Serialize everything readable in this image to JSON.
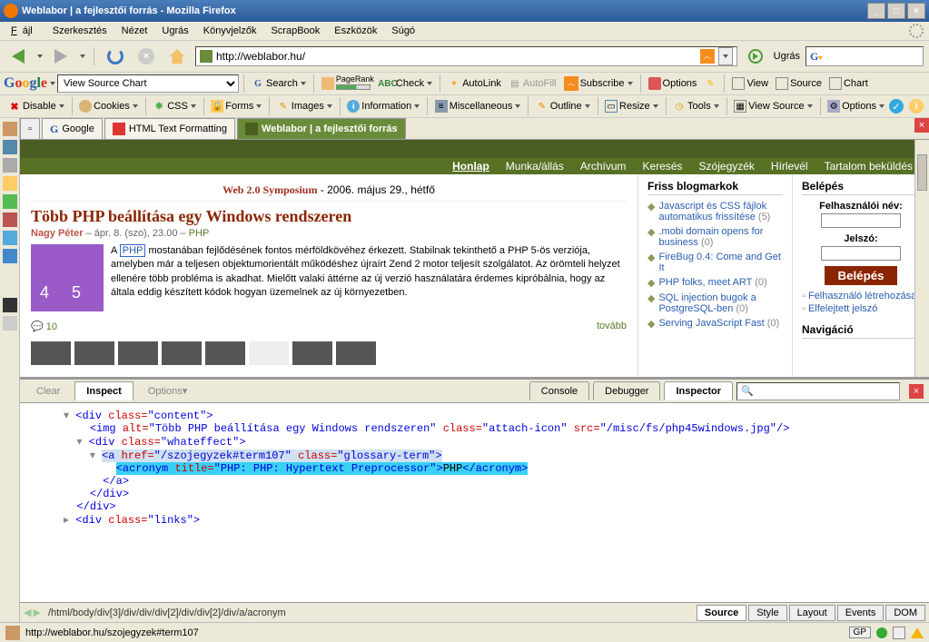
{
  "window": {
    "title": "Weblabor | a fejlesztői forrás - Mozilla Firefox",
    "min": "_",
    "max": "□",
    "close": "×"
  },
  "menu": {
    "file": "Fájl",
    "edit": "Szerkesztés",
    "view": "Nézet",
    "go": "Ugrás",
    "bookmarks": "Könyvjelzők",
    "scrapbook": "ScrapBook",
    "tools": "Eszközök",
    "help": "Súgó"
  },
  "nav": {
    "url": "http://weblabor.hu/",
    "go_label": "Ugrás"
  },
  "google_bar": {
    "search_value": "View Source Chart",
    "search": "Search",
    "pagerank": "PageRank",
    "abc": "ABC",
    "check": "Check",
    "autolink": "AutoLink",
    "autofill": "AutoFill",
    "subscribe": "Subscribe",
    "options": "Options",
    "view": "View",
    "source": "Source",
    "chart": "Chart"
  },
  "webdev_bar": {
    "disable": "Disable",
    "cookies": "Cookies",
    "css": "CSS",
    "forms": "Forms",
    "images": "Images",
    "info": "Information",
    "misc": "Miscellaneous",
    "outline": "Outline",
    "resize": "Resize",
    "tools": "Tools",
    "viewsource": "View Source",
    "options": "Options"
  },
  "tabs": {
    "google": "Google",
    "htmlfmt": "HTML Text Formatting",
    "weblabor": "Weblabor | a fejlesztői forrás"
  },
  "weblabor_nav": [
    "Honlap",
    "Munka/állás",
    "Archívum",
    "Keresés",
    "Szójegyzék",
    "Hírlevél",
    "Tartalom beküldés"
  ],
  "symposium": {
    "title": "Web 2.0 Symposium",
    "date": " - 2006. május 29., hétfő"
  },
  "article": {
    "title": "Több PHP beállítása egy Windows rendszeren",
    "author": "Nagy Péter",
    "meta_sep": " – ápr. 8. (szo), 23.00 – ",
    "php": "PHP",
    "body_pre": "A ",
    "php_hl": "PHP",
    "body": " mostanában fejlődésének fontos mérföldkövéhez érkezett. Stabilnak tekinthető a PHP 5-ös verziója, amelyben már a teljesen objektumorientált működéshez újraírt Zend 2 motor teljesít szolgálatot. Az örömteli helyzet ellenére több probléma is akadhat. Mielőtt valaki áttérne az új verzió használatára érdemes kipróbálnia, hogy az általa eddig készített kódok hogyan üzemelnek az új környezetben.",
    "comments_icon": "💬",
    "comments": "10",
    "more": "tovább"
  },
  "blogmarks": {
    "title": "Friss blogmarkok",
    "items": [
      {
        "text": "Javascript és CSS fájlok automatikus frissítése",
        "count": "(5)"
      },
      {
        "text": ".mobi domain opens for business",
        "count": "(0)"
      },
      {
        "text": "FireBug 0.4: Come and Get It",
        "count": ""
      },
      {
        "text": "PHP folks, meet ART",
        "count": "(0)"
      },
      {
        "text": "SQL injection bugok a PostgreSQL-ben",
        "count": "(0)"
      },
      {
        "text": "Serving JavaScript Fast",
        "count": "(0)"
      }
    ]
  },
  "login": {
    "title": "Belépés",
    "user": "Felhasználói név:",
    "pass": "Jelszó:",
    "button": "Belépés",
    "links": [
      "Felhasználó létrehozása",
      "Elfelejtett jelszó"
    ],
    "nav_title": "Navigáció"
  },
  "firebug": {
    "clear": "Clear",
    "inspect": "Inspect",
    "options": "Options",
    "console": "Console",
    "debugger": "Debugger",
    "inspector": "Inspector",
    "bottom_buttons": [
      "Source",
      "Style",
      "Layout",
      "Events",
      "DOM"
    ],
    "breadcrumb": "/html/body/div[3]/div/div/div[2]/div/div[2]/div/a/acronym",
    "code": {
      "l1_open": "<div ",
      "l1_attr": "class=",
      "l1_val": "\"content\"",
      "l1_close": ">",
      "l2_open": "<img ",
      "l2_alt": "alt=",
      "l2_alt_v": "\"Több PHP beállítása egy Windows rendszeren\"",
      "l2_cls": " class=",
      "l2_cls_v": "\"attach-icon\"",
      "l2_src": " src=",
      "l2_src_v": "\"/misc/fs/php45windows.jpg\"",
      "l2_end": "/>",
      "l3_open": "<div ",
      "l3_cls": "class=",
      "l3_val": "\"whateffect\"",
      "l3_close": ">",
      "l4_open": "<a ",
      "l4_href": "href=",
      "l4_href_v": "\"/szojegyzek#term107\"",
      "l4_cls": " class=",
      "l4_cls_v": "\"glossary-term\"",
      "l4_close": ">",
      "l5_open": "<acronym ",
      "l5_title": "title=",
      "l5_title_v": "\"PHP: PHP: Hypertext Preprocessor\"",
      "l5_mid": ">",
      "l5_text": "PHP",
      "l5_close": "</acronym>",
      "l6": "</a>",
      "l7": "</div>",
      "l8": "</div>",
      "l9_open": "<div ",
      "l9_cls": "class=",
      "l9_val": "\"links\"",
      "l9_close": ">"
    }
  },
  "status": {
    "url": "http://weblabor.hu/szojegyzek#term107",
    "gp": "GP"
  }
}
